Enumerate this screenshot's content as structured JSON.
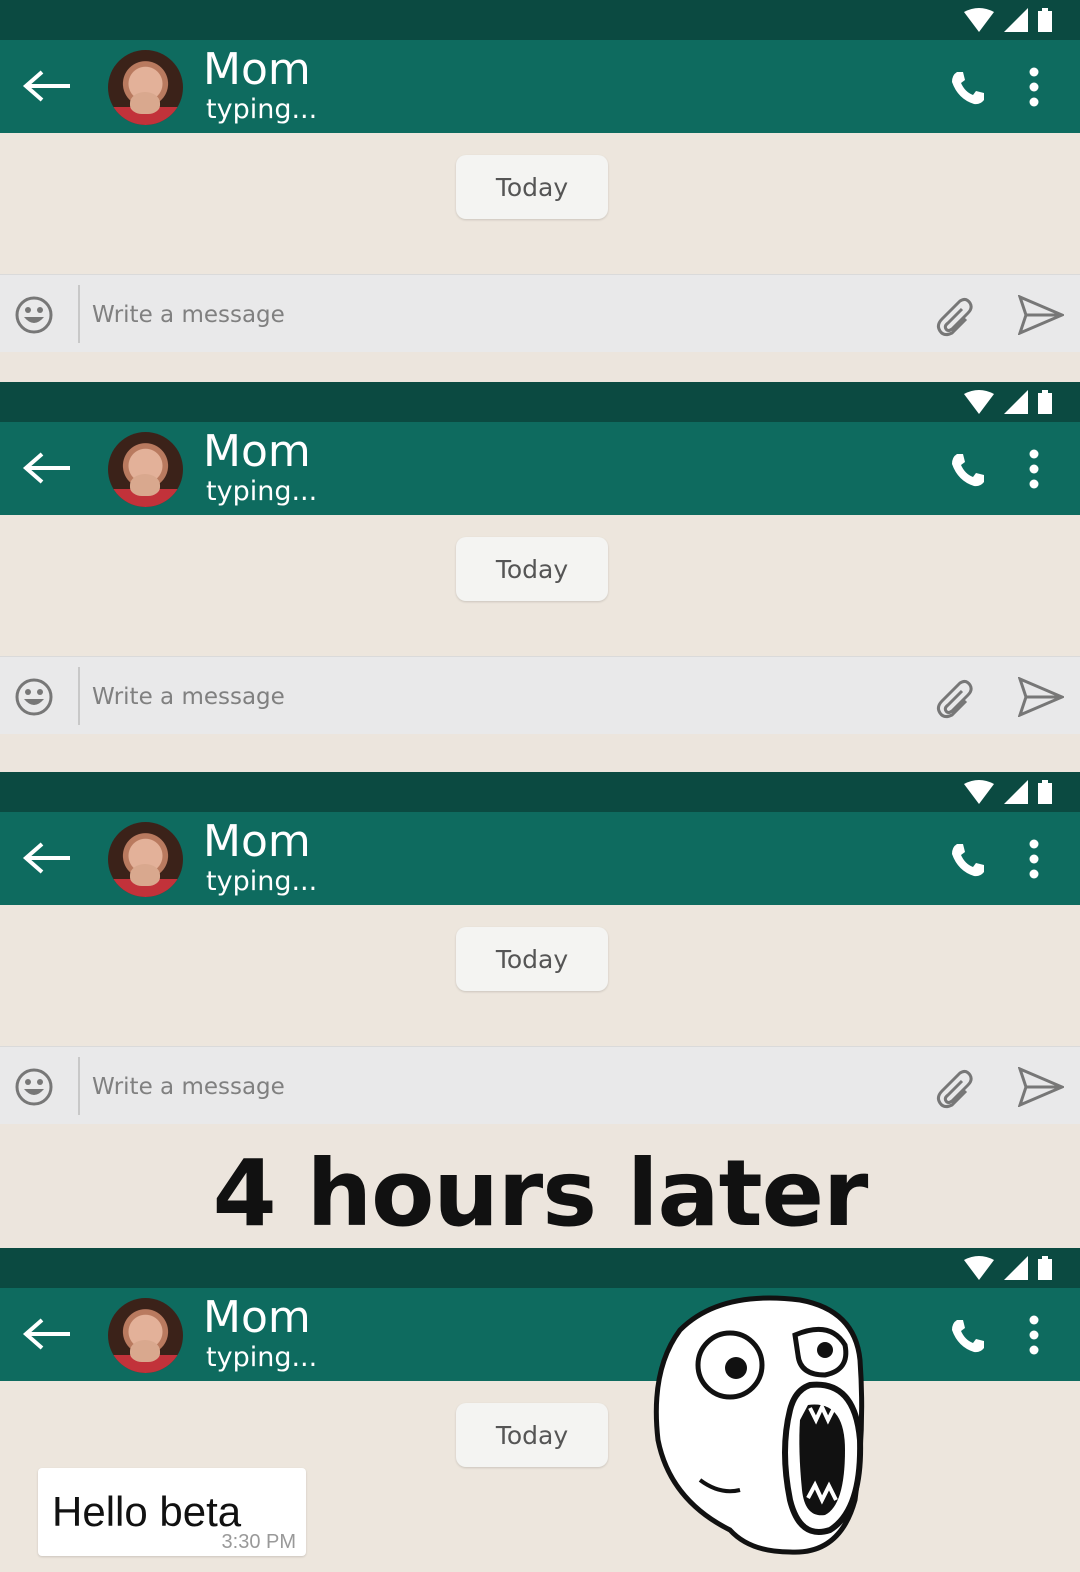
{
  "panels": [
    {
      "contact": {
        "name": "Mom",
        "status": "typing..."
      },
      "date_chip": "Today",
      "input": {
        "placeholder": "Write a message"
      }
    },
    {
      "contact": {
        "name": "Mom",
        "status": "typing..."
      },
      "date_chip": "Today",
      "input": {
        "placeholder": "Write a message"
      }
    },
    {
      "contact": {
        "name": "Mom",
        "status": "typing..."
      },
      "date_chip": "Today",
      "input": {
        "placeholder": "Write a message"
      }
    },
    {
      "contact": {
        "name": "Mom",
        "status": "typing..."
      },
      "date_chip": "Today",
      "message": {
        "text": "Hello beta",
        "time": "3:30 PM"
      }
    }
  ],
  "caption": "4 hours later",
  "icons": [
    "wifi-icon",
    "signal-icon",
    "battery-icon",
    "back-arrow-icon",
    "phone-icon",
    "more-vert-icon",
    "emoji-icon",
    "paperclip-icon",
    "send-icon",
    "rage-face-icon"
  ],
  "colors": {
    "statusbar": "#0b4a41",
    "appbar": "#0e6b5f",
    "chat_bg": "#ede6dd",
    "input_bg": "#e9e9ea"
  }
}
